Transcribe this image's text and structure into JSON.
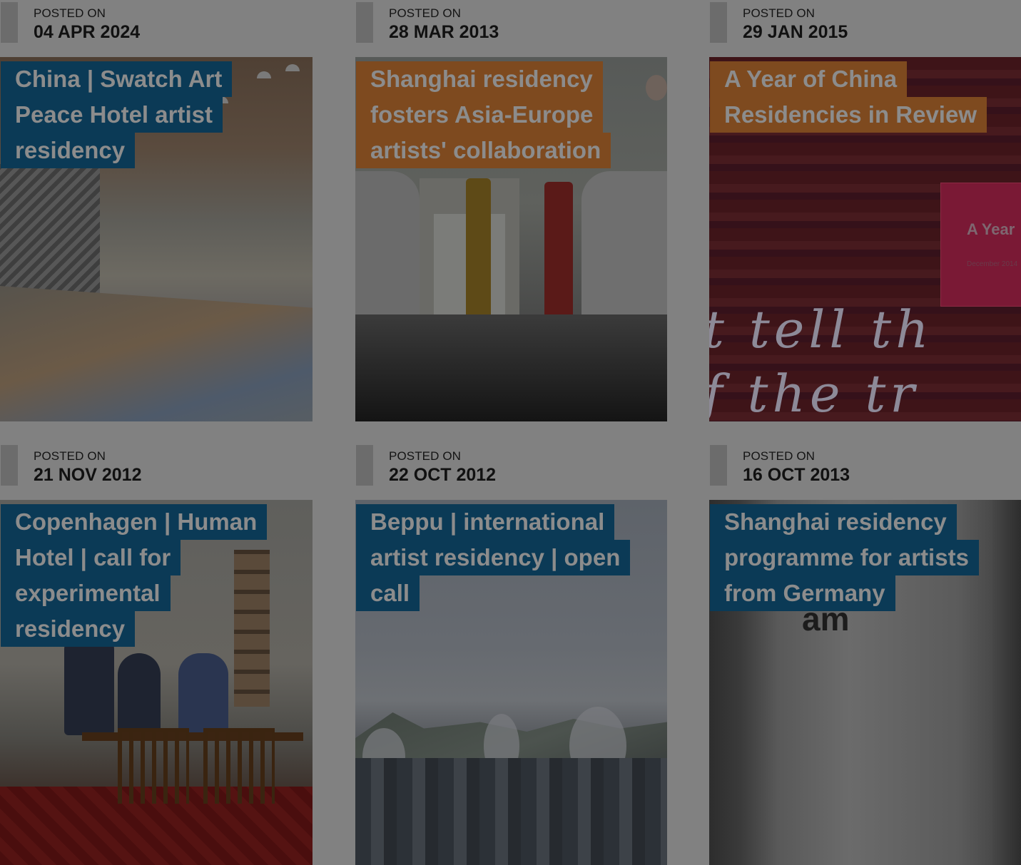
{
  "posts": [
    {
      "posted_label": "POSTED ON",
      "date": "04 APR 2024",
      "title_lines": [
        "China | Swatch Art",
        "Peace Hotel artist",
        "residency"
      ],
      "title_style": "blue"
    },
    {
      "posted_label": "POSTED ON",
      "date": "28 MAR 2013",
      "title_lines": [
        "Shanghai residency",
        "fosters Asia-Europe",
        "artists' collaboration"
      ],
      "title_style": "orange"
    },
    {
      "posted_label": "POSTED ON",
      "date": "29 JAN 2015",
      "title_lines": [
        "A Year of China",
        "Residencies in Review"
      ],
      "title_style": "orange",
      "image_text": "A Year",
      "image_subtext": "December 2014"
    },
    {
      "posted_label": "POSTED ON",
      "date": "21 NOV 2012",
      "title_lines": [
        "Copenhagen | Human",
        "Hotel | call for",
        "experimental",
        "residency"
      ],
      "title_style": "blue"
    },
    {
      "posted_label": "POSTED ON",
      "date": "22 OCT 2012",
      "title_lines": [
        "Beppu | international",
        "artist residency | open",
        "call"
      ],
      "title_style": "blue"
    },
    {
      "posted_label": "POSTED ON",
      "date": "16 OCT 2013",
      "title_lines": [
        "Shanghai residency",
        "programme for artists",
        "from Germany"
      ],
      "title_style": "blue",
      "image_text": "am"
    }
  ],
  "colors": {
    "overlay_bg": "#818181",
    "title_blue": "#0b3a56",
    "title_orange": "#7e4a1f"
  }
}
